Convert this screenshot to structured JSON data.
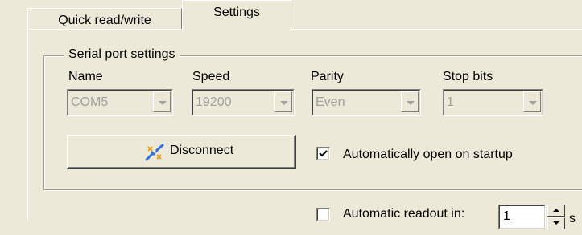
{
  "tabs": [
    {
      "label": "Quick read/write",
      "active": false
    },
    {
      "label": "Settings",
      "active": true
    }
  ],
  "serial_port": {
    "group_title": "Serial port settings",
    "fields": {
      "name": {
        "label": "Name",
        "value": "COM5"
      },
      "speed": {
        "label": "Speed",
        "value": "19200"
      },
      "parity": {
        "label": "Parity",
        "value": "Even"
      },
      "stop_bits": {
        "label": "Stop bits",
        "value": "1"
      }
    },
    "disconnect_button": {
      "label": "Disconnect",
      "icon": "disconnect-plug-icon"
    },
    "auto_open": {
      "label": "Automatically open on startup",
      "checked": true
    }
  },
  "auto_readout": {
    "label": "Automatic readout in:",
    "checked": false,
    "value": "1",
    "unit": "s"
  },
  "colors": {
    "background": "#ece9d8",
    "disabled_text": "#a0a0a0"
  }
}
